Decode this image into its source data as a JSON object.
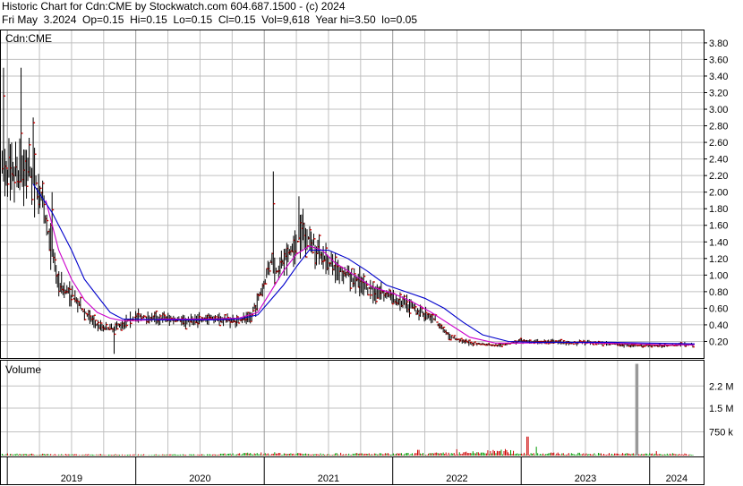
{
  "header": {
    "line1": "Historic Chart for Cdn:CME by Stockwatch.com 604.687.1500 - (c) 2024",
    "line2": "Fri May  3.2024  Op=0.15  Hi=0.15  Lo=0.15  Cl=0.15  Vol=9,618  Year hi=3.50  lo=0.05"
  },
  "price_panel_label": "Cdn:CME",
  "volume_panel_label": "Volume",
  "colors": {
    "price_bar": "#000000",
    "close_tick": "#cc0000",
    "ma_short": "#cc00cc",
    "ma_long": "#0000cc",
    "volume_up": "#009900",
    "volume_down": "#cc0000",
    "grid": "#c0c0c0"
  },
  "chart_data": [
    {
      "type": "line",
      "subtype": "ohlc",
      "title": "Cdn:CME",
      "y_ticks": [
        "3.80",
        "3.60",
        "3.40",
        "3.20",
        "3.00",
        "2.80",
        "2.60",
        "2.40",
        "2.20",
        "2.00",
        "1.80",
        "1.60",
        "1.40",
        "1.20",
        "1.00",
        "0.80",
        "0.60",
        "0.40",
        "0.20"
      ],
      "ylim": [
        0.0,
        3.95
      ],
      "x_labels": [
        "2019",
        "2020",
        "2021",
        "2022",
        "2023",
        "2024"
      ],
      "x_years": [
        2019.0,
        2020.0,
        2021.0,
        2022.0,
        2023.0,
        2024.0
      ],
      "xlim": [
        2018.95,
        2024.42
      ],
      "price_keypoints": {
        "x": [
          2018.95,
          2019.05,
          2019.15,
          2019.25,
          2019.32,
          2019.4,
          2019.5,
          2019.6,
          2019.7,
          2019.8,
          2019.9,
          2020.0,
          2020.2,
          2020.4,
          2020.6,
          2020.8,
          2020.9,
          2020.95,
          2021.0,
          2021.05,
          2021.1,
          2021.2,
          2021.3,
          2021.4,
          2021.5,
          2021.6,
          2021.7,
          2021.8,
          2021.9,
          2022.0,
          2022.15,
          2022.3,
          2022.45,
          2022.6,
          2022.8,
          2023.0,
          2023.3,
          2023.6,
          2023.9,
          2024.1,
          2024.3,
          2024.35
        ],
        "y": [
          2.3,
          2.2,
          2.3,
          2.0,
          1.5,
          0.9,
          0.75,
          0.55,
          0.4,
          0.35,
          0.42,
          0.5,
          0.48,
          0.45,
          0.48,
          0.45,
          0.5,
          0.7,
          0.9,
          1.15,
          1.05,
          1.25,
          1.5,
          1.35,
          1.15,
          1.05,
          0.95,
          0.85,
          0.8,
          0.72,
          0.6,
          0.5,
          0.25,
          0.18,
          0.15,
          0.2,
          0.19,
          0.18,
          0.15,
          0.15,
          0.17,
          0.15
        ]
      },
      "spikes": [
        {
          "x": 2018.97,
          "hi": 3.5
        },
        {
          "x": 2019.03,
          "hi": 2.6
        },
        {
          "x": 2019.11,
          "hi": 3.5
        },
        {
          "x": 2019.2,
          "hi": 2.9
        },
        {
          "x": 2019.35,
          "hi": 2.0
        },
        {
          "x": 2019.83,
          "lo": 0.05
        },
        {
          "x": 2021.07,
          "hi": 2.25
        },
        {
          "x": 2021.27,
          "hi": 1.95
        },
        {
          "x": 2021.3,
          "hi": 1.8
        }
      ],
      "series": [
        {
          "name": "",
          "x": [
            2019.3,
            2019.4,
            2019.5,
            2019.6,
            2019.7,
            2019.8,
            2019.9,
            2020.0,
            2020.2,
            2020.4,
            2020.6,
            2020.8,
            2020.95,
            2021.05,
            2021.15,
            2021.25,
            2021.35,
            2021.45,
            2021.55,
            2021.7,
            2021.85,
            2022.0,
            2022.15,
            2022.3,
            2022.45,
            2022.6,
            2022.8,
            2023.0,
            2023.3,
            2023.6,
            2023.9,
            2024.1,
            2024.35
          ],
          "y": [
            1.9,
            1.3,
            0.95,
            0.7,
            0.55,
            0.48,
            0.45,
            0.45,
            0.47,
            0.47,
            0.47,
            0.48,
            0.55,
            0.8,
            1.05,
            1.25,
            1.35,
            1.3,
            1.15,
            1.0,
            0.85,
            0.78,
            0.68,
            0.55,
            0.4,
            0.25,
            0.18,
            0.18,
            0.19,
            0.18,
            0.17,
            0.16,
            0.16
          ]
        },
        {
          "name": "",
          "x": [
            2019.2,
            2019.35,
            2019.5,
            2019.6,
            2019.7,
            2019.8,
            2019.9,
            2020.0,
            2020.2,
            2020.4,
            2020.6,
            2020.8,
            2020.95,
            2021.05,
            2021.15,
            2021.25,
            2021.35,
            2021.5,
            2021.65,
            2021.8,
            2021.95,
            2022.1,
            2022.25,
            2022.4,
            2022.55,
            2022.7,
            2022.9,
            2023.1,
            2023.4,
            2023.7,
            2024.0,
            2024.35
          ],
          "y": [
            2.1,
            1.75,
            1.3,
            0.95,
            0.75,
            0.55,
            0.47,
            0.47,
            0.46,
            0.46,
            0.46,
            0.47,
            0.52,
            0.7,
            0.88,
            1.1,
            1.3,
            1.3,
            1.2,
            1.05,
            0.88,
            0.8,
            0.72,
            0.6,
            0.43,
            0.28,
            0.2,
            0.19,
            0.19,
            0.19,
            0.18,
            0.17
          ]
        }
      ]
    },
    {
      "type": "bar",
      "title": "Volume",
      "y_ticks": [
        "2.2 M",
        "1.5 M",
        "750 k"
      ],
      "y_tick_values": [
        2200000,
        1500000,
        750000
      ],
      "ylim": [
        0,
        3000000
      ],
      "volume_keypoints": {
        "x": [
          2018.95,
          2019.5,
          2020.0,
          2020.5,
          2021.0,
          2021.5,
          2022.0,
          2022.5,
          2022.9,
          2023.0,
          2023.5,
          2024.0,
          2024.35
        ],
        "y": [
          40000,
          30000,
          25000,
          25000,
          60000,
          50000,
          45000,
          60000,
          120000,
          60000,
          50000,
          45000,
          40000
        ]
      },
      "volume_spikes": [
        {
          "x": 2022.2,
          "v": 180000
        },
        {
          "x": 2022.5,
          "v": 200000
        },
        {
          "x": 2023.05,
          "v": 600000
        },
        {
          "x": 2023.12,
          "v": 280000
        },
        {
          "x": 2023.9,
          "v": 2900000
        },
        {
          "x": 2024.05,
          "v": 140000
        }
      ]
    }
  ]
}
